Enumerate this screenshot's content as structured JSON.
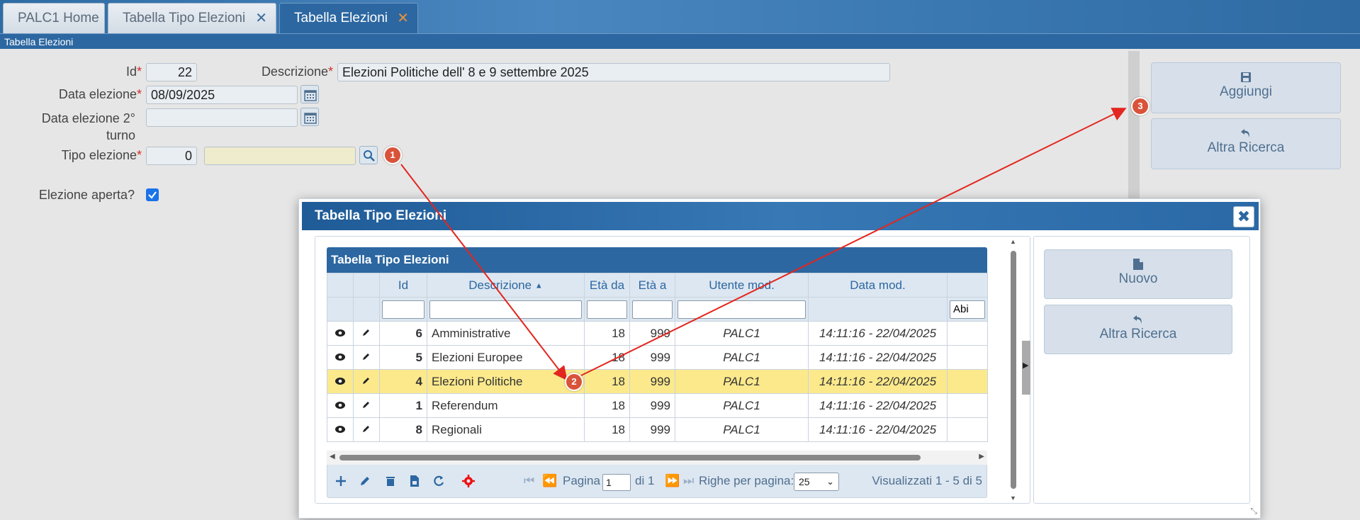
{
  "tabs": [
    {
      "label": "PALC1 Home",
      "closable": false,
      "active": false
    },
    {
      "label": "Tabella Tipo Elezioni",
      "closable": true,
      "active": false
    },
    {
      "label": "Tabella Elezioni",
      "closable": true,
      "active": true
    }
  ],
  "breadcrumb": "Tabella Elezioni",
  "form": {
    "id_label": "Id",
    "id_value": "22",
    "descrizione_label": "Descrizione",
    "descrizione_value": "Elezioni Politiche dell' 8 e 9 settembre 2025",
    "data_elezione_label": "Data elezione",
    "data_elezione_value": "08/09/2025",
    "data_turno2_label_line1": "Data elezione 2°",
    "data_turno2_label_line2": "turno",
    "data_turno2_value": "",
    "tipo_elezione_label": "Tipo elezione",
    "tipo_elezione_code": "0",
    "tipo_elezione_desc": "",
    "elezione_aperta_label": "Elezione aperta?",
    "elezione_aperta_checked": true,
    "required_mark": "*"
  },
  "side_actions": {
    "aggiungi": "Aggiungi",
    "altra_ricerca": "Altra Ricerca"
  },
  "dialog": {
    "title": "Tabella Tipo Elezioni",
    "close_glyph": "✖",
    "grid_title": "Tabella Tipo Elezioni",
    "columns": [
      "",
      "",
      "Id",
      "Descrizione",
      "Età da",
      "Età a",
      "Utente mod.",
      "Data mod.",
      ""
    ],
    "filter_partial": "Abi",
    "rows": [
      {
        "id": "6",
        "descrizione": "Amministrative",
        "eta_da": "18",
        "eta_a": "999",
        "utente": "PALC1",
        "data_mod": "14:11:16 - 22/04/2025",
        "selected": false
      },
      {
        "id": "5",
        "descrizione": "Elezioni Europee",
        "eta_da": "18",
        "eta_a": "999",
        "utente": "PALC1",
        "data_mod": "14:11:16 - 22/04/2025",
        "selected": false
      },
      {
        "id": "4",
        "descrizione": "Elezioni Politiche",
        "eta_da": "18",
        "eta_a": "999",
        "utente": "PALC1",
        "data_mod": "14:11:16 - 22/04/2025",
        "selected": true
      },
      {
        "id": "1",
        "descrizione": "Referendum",
        "eta_da": "18",
        "eta_a": "999",
        "utente": "PALC1",
        "data_mod": "14:11:16 - 22/04/2025",
        "selected": false
      },
      {
        "id": "8",
        "descrizione": "Regionali",
        "eta_da": "18",
        "eta_a": "999",
        "utente": "PALC1",
        "data_mod": "14:11:16 - 22/04/2025",
        "selected": false
      }
    ],
    "pager": {
      "pagina_label": "Pagina",
      "page": "1",
      "di_label": "di 1",
      "righe_label": "Righe per pagina:",
      "righe_value": "25",
      "visualizzati": "Visualizzati 1 - 5 di 5"
    },
    "side_actions": {
      "nuovo": "Nuovo",
      "altra_ricerca": "Altra Ricerca"
    }
  },
  "annotations": {
    "step1": "1",
    "step2": "2",
    "step3": "3",
    "arrow_color": "#e3261f"
  },
  "colors": {
    "primary": "#2c67a1",
    "selected_row": "#fbe98c",
    "required": "#d0302b",
    "badge": "#d9533a",
    "tab_close_active": "#e8923c"
  }
}
